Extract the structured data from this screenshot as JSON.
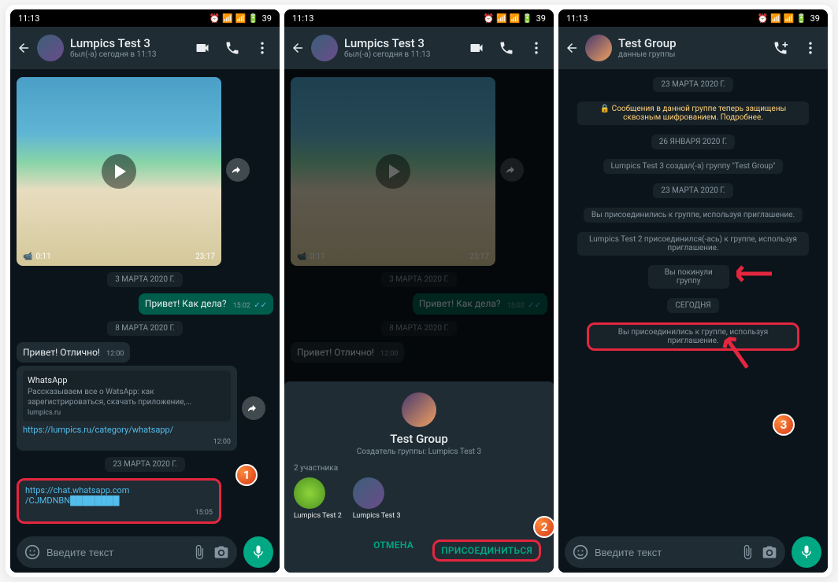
{
  "status": {
    "time": "11:13",
    "battery": "39"
  },
  "chat1": {
    "name": "Lumpics Test 3",
    "subtitle": "был(-а) сегодня в 11:13",
    "video": {
      "duration": "0:11",
      "time": "23:17"
    },
    "date1": "3 МАРТА 2020 Г.",
    "msg_out1": "Привет! Как дела?",
    "msg_out1_ts": "15:02",
    "date2": "8 МАРТА 2020 Г.",
    "msg_in1": "Привет! Отлично!",
    "msg_in1_ts": "12:00",
    "link_card_title": "WhatsApp",
    "link_card_desc": "Рассказываем все о WatsApp: как зарегистрироваться, скачать приложение,...",
    "link_card_domain": "lumpics.ru",
    "link1": "https://lumpics.ru/category/whatsapp/",
    "link1_ts": "12:00",
    "date3": "23 МАРТА 2020 Г.",
    "link2a": "https://chat.whatsapp.com",
    "link2b": "/CJMDNBN",
    "link2_ts": "15:05"
  },
  "sheet": {
    "group_name": "Test Group",
    "creator": "Создатель группы: Lumpics Test 3",
    "participants_count": "2 участника",
    "p1": "Lumpics Test 2",
    "p2": "Lumpics Test 3",
    "cancel": "ОТМЕНА",
    "join": "ПРИСОЕДИНИТЬСЯ"
  },
  "group": {
    "name": "Test Group",
    "subtitle": "данные группы",
    "date1": "23 МАРТА 2020 Г.",
    "encrypt": "🔒 Сообщения в данной группе теперь защищены сквозным шифрованием. Подробнее.",
    "date2": "26 ЯНВАРЯ 2020 Г.",
    "sys1": "Lumpics Test 3 создал(-а) группу \"Test Group\"",
    "date3": "23 МАРТА 2020 Г.",
    "sys2": "Вы присоединились к группе, используя приглашение.",
    "sys3": "Lumpics Test 2 присоединился(-ась) к группе, используя приглашение.",
    "sys4": "Вы покинули группу",
    "today": "СЕГОДНЯ",
    "sys5": "Вы присоединились к группе, используя приглашение."
  },
  "input_placeholder": "Введите текст",
  "steps": {
    "s1": "1",
    "s2": "2",
    "s3": "3"
  }
}
